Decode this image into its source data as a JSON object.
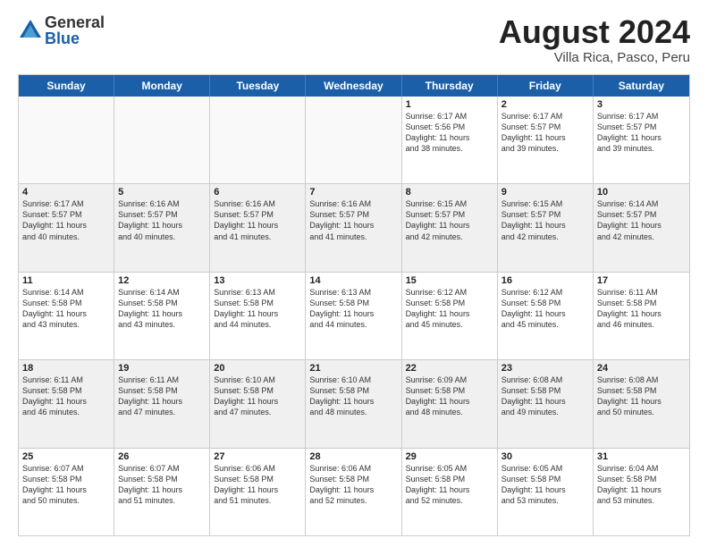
{
  "logo": {
    "general": "General",
    "blue": "Blue"
  },
  "title": "August 2024",
  "location": "Villa Rica, Pasco, Peru",
  "header_days": [
    "Sunday",
    "Monday",
    "Tuesday",
    "Wednesday",
    "Thursday",
    "Friday",
    "Saturday"
  ],
  "rows": [
    [
      {
        "day": "",
        "text": "",
        "empty": true
      },
      {
        "day": "",
        "text": "",
        "empty": true
      },
      {
        "day": "",
        "text": "",
        "empty": true
      },
      {
        "day": "",
        "text": "",
        "empty": true
      },
      {
        "day": "1",
        "text": "Sunrise: 6:17 AM\nSunset: 5:56 PM\nDaylight: 11 hours\nand 38 minutes."
      },
      {
        "day": "2",
        "text": "Sunrise: 6:17 AM\nSunset: 5:57 PM\nDaylight: 11 hours\nand 39 minutes."
      },
      {
        "day": "3",
        "text": "Sunrise: 6:17 AM\nSunset: 5:57 PM\nDaylight: 11 hours\nand 39 minutes."
      }
    ],
    [
      {
        "day": "4",
        "text": "Sunrise: 6:17 AM\nSunset: 5:57 PM\nDaylight: 11 hours\nand 40 minutes."
      },
      {
        "day": "5",
        "text": "Sunrise: 6:16 AM\nSunset: 5:57 PM\nDaylight: 11 hours\nand 40 minutes."
      },
      {
        "day": "6",
        "text": "Sunrise: 6:16 AM\nSunset: 5:57 PM\nDaylight: 11 hours\nand 41 minutes."
      },
      {
        "day": "7",
        "text": "Sunrise: 6:16 AM\nSunset: 5:57 PM\nDaylight: 11 hours\nand 41 minutes."
      },
      {
        "day": "8",
        "text": "Sunrise: 6:15 AM\nSunset: 5:57 PM\nDaylight: 11 hours\nand 42 minutes."
      },
      {
        "day": "9",
        "text": "Sunrise: 6:15 AM\nSunset: 5:57 PM\nDaylight: 11 hours\nand 42 minutes."
      },
      {
        "day": "10",
        "text": "Sunrise: 6:14 AM\nSunset: 5:57 PM\nDaylight: 11 hours\nand 42 minutes."
      }
    ],
    [
      {
        "day": "11",
        "text": "Sunrise: 6:14 AM\nSunset: 5:58 PM\nDaylight: 11 hours\nand 43 minutes."
      },
      {
        "day": "12",
        "text": "Sunrise: 6:14 AM\nSunset: 5:58 PM\nDaylight: 11 hours\nand 43 minutes."
      },
      {
        "day": "13",
        "text": "Sunrise: 6:13 AM\nSunset: 5:58 PM\nDaylight: 11 hours\nand 44 minutes."
      },
      {
        "day": "14",
        "text": "Sunrise: 6:13 AM\nSunset: 5:58 PM\nDaylight: 11 hours\nand 44 minutes."
      },
      {
        "day": "15",
        "text": "Sunrise: 6:12 AM\nSunset: 5:58 PM\nDaylight: 11 hours\nand 45 minutes."
      },
      {
        "day": "16",
        "text": "Sunrise: 6:12 AM\nSunset: 5:58 PM\nDaylight: 11 hours\nand 45 minutes."
      },
      {
        "day": "17",
        "text": "Sunrise: 6:11 AM\nSunset: 5:58 PM\nDaylight: 11 hours\nand 46 minutes."
      }
    ],
    [
      {
        "day": "18",
        "text": "Sunrise: 6:11 AM\nSunset: 5:58 PM\nDaylight: 11 hours\nand 46 minutes."
      },
      {
        "day": "19",
        "text": "Sunrise: 6:11 AM\nSunset: 5:58 PM\nDaylight: 11 hours\nand 47 minutes."
      },
      {
        "day": "20",
        "text": "Sunrise: 6:10 AM\nSunset: 5:58 PM\nDaylight: 11 hours\nand 47 minutes."
      },
      {
        "day": "21",
        "text": "Sunrise: 6:10 AM\nSunset: 5:58 PM\nDaylight: 11 hours\nand 48 minutes."
      },
      {
        "day": "22",
        "text": "Sunrise: 6:09 AM\nSunset: 5:58 PM\nDaylight: 11 hours\nand 48 minutes."
      },
      {
        "day": "23",
        "text": "Sunrise: 6:08 AM\nSunset: 5:58 PM\nDaylight: 11 hours\nand 49 minutes."
      },
      {
        "day": "24",
        "text": "Sunrise: 6:08 AM\nSunset: 5:58 PM\nDaylight: 11 hours\nand 50 minutes."
      }
    ],
    [
      {
        "day": "25",
        "text": "Sunrise: 6:07 AM\nSunset: 5:58 PM\nDaylight: 11 hours\nand 50 minutes."
      },
      {
        "day": "26",
        "text": "Sunrise: 6:07 AM\nSunset: 5:58 PM\nDaylight: 11 hours\nand 51 minutes."
      },
      {
        "day": "27",
        "text": "Sunrise: 6:06 AM\nSunset: 5:58 PM\nDaylight: 11 hours\nand 51 minutes."
      },
      {
        "day": "28",
        "text": "Sunrise: 6:06 AM\nSunset: 5:58 PM\nDaylight: 11 hours\nand 52 minutes."
      },
      {
        "day": "29",
        "text": "Sunrise: 6:05 AM\nSunset: 5:58 PM\nDaylight: 11 hours\nand 52 minutes."
      },
      {
        "day": "30",
        "text": "Sunrise: 6:05 AM\nSunset: 5:58 PM\nDaylight: 11 hours\nand 53 minutes."
      },
      {
        "day": "31",
        "text": "Sunrise: 6:04 AM\nSunset: 5:58 PM\nDaylight: 11 hours\nand 53 minutes."
      }
    ]
  ]
}
